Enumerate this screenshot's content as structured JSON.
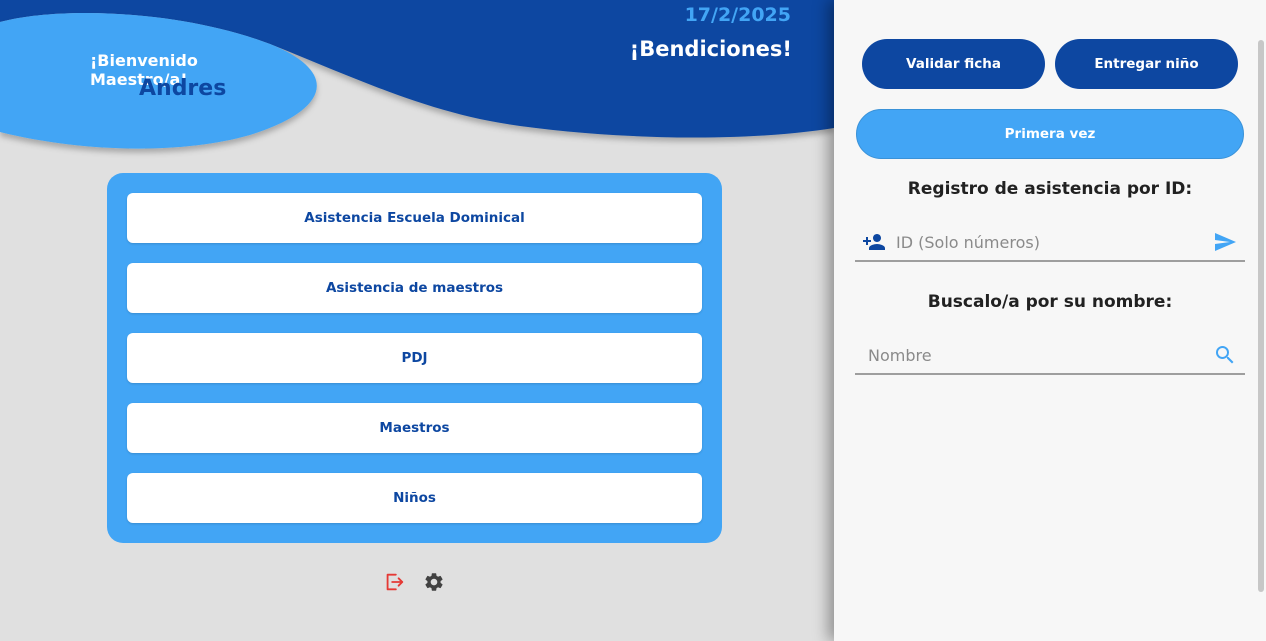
{
  "header": {
    "greeting": "¡Bienvenido Maestro/a!",
    "teacher_name": "Andres",
    "date": "17/2/2025",
    "blessing": "¡Bendiciones!"
  },
  "menu": {
    "items": [
      {
        "label": "Asistencia Escuela Dominical"
      },
      {
        "label": "Asistencia de maestros"
      },
      {
        "label": "PDJ"
      },
      {
        "label": "Maestros"
      },
      {
        "label": "Niños"
      }
    ]
  },
  "footer_icons": [
    {
      "icon": "logout-icon",
      "color": "#e53935"
    },
    {
      "icon": "gear-icon",
      "color": "#424242"
    }
  ],
  "panel": {
    "validate_label": "Validar ficha",
    "deliver_label": "Entregar niño",
    "first_time_label": "Primera vez",
    "id_section_title": "Registro de asistencia por ID:",
    "id_placeholder": "ID (Solo números)",
    "id_value": "",
    "name_section_title": "Buscalo/a por su nombre:",
    "name_placeholder": "Nombre",
    "name_value": ""
  },
  "colors": {
    "primary_dark": "#0d47a1",
    "primary_light": "#42a5f5",
    "background": "#e0e0e0",
    "panel_bg": "#f7f7f7",
    "logout": "#e53935"
  }
}
